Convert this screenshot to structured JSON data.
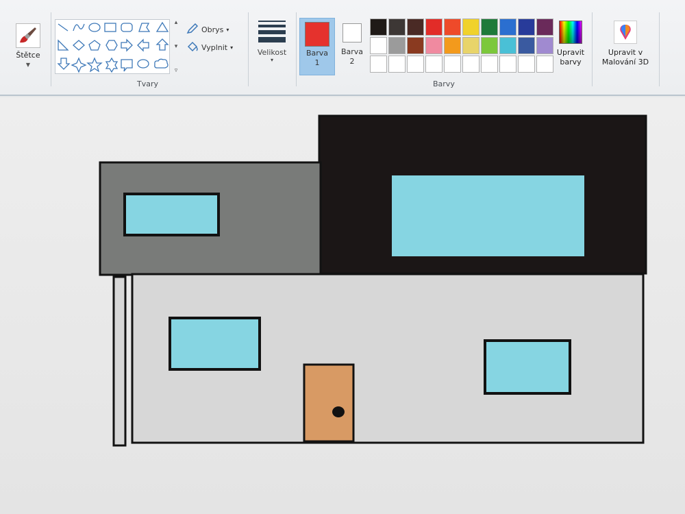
{
  "ribbon": {
    "brushes_label": "Štětce",
    "shapes_group_label": "Tvary",
    "outline_label": "Obrys",
    "fill_label": "Vyplnit",
    "size_label": "Velikost",
    "color1_label": "Barva 1",
    "color2_label": "Barva 2",
    "colors_group_label": "Barvy",
    "edit_colors_label": "Upravit barvy",
    "paint3d_label": "Upravit v Malování 3D"
  },
  "colors": {
    "color1": "#e5322d",
    "color2": "#ffffff",
    "palette": [
      "#1f1a17",
      "#3d3735",
      "#4a2a25",
      "#e22c28",
      "#ee4a2a",
      "#f0d22c",
      "#1e7a3a",
      "#2b6fd0",
      "#283b9a",
      "#6a2a5a",
      "#ffffff",
      "#9b9b9b",
      "#8a3a20",
      "#f08aa0",
      "#f39a1c",
      "#e8d46a",
      "#7cc83c",
      "#4ac0d6",
      "#3a5aa0",
      "#a08ad0",
      "#ffffff",
      "#ffffff",
      "#ffffff",
      "#ffffff",
      "#ffffff",
      "#ffffff",
      "#ffffff",
      "#ffffff",
      "#ffffff",
      "#ffffff"
    ],
    "house": {
      "wall": "#d7d7d7",
      "upper_left": "#797b79",
      "upper_right": "#1b1616",
      "glass": "#86d5e2",
      "door": "#d89a64",
      "outline": "#121212"
    }
  },
  "icons": {
    "brushes": "brush-icon",
    "outline": "pencil-icon",
    "fill": "paint-bucket-icon",
    "size": "line-thickness-icon",
    "edit_colors": "color-spectrum-icon",
    "paint3d": "paint3d-icon"
  }
}
